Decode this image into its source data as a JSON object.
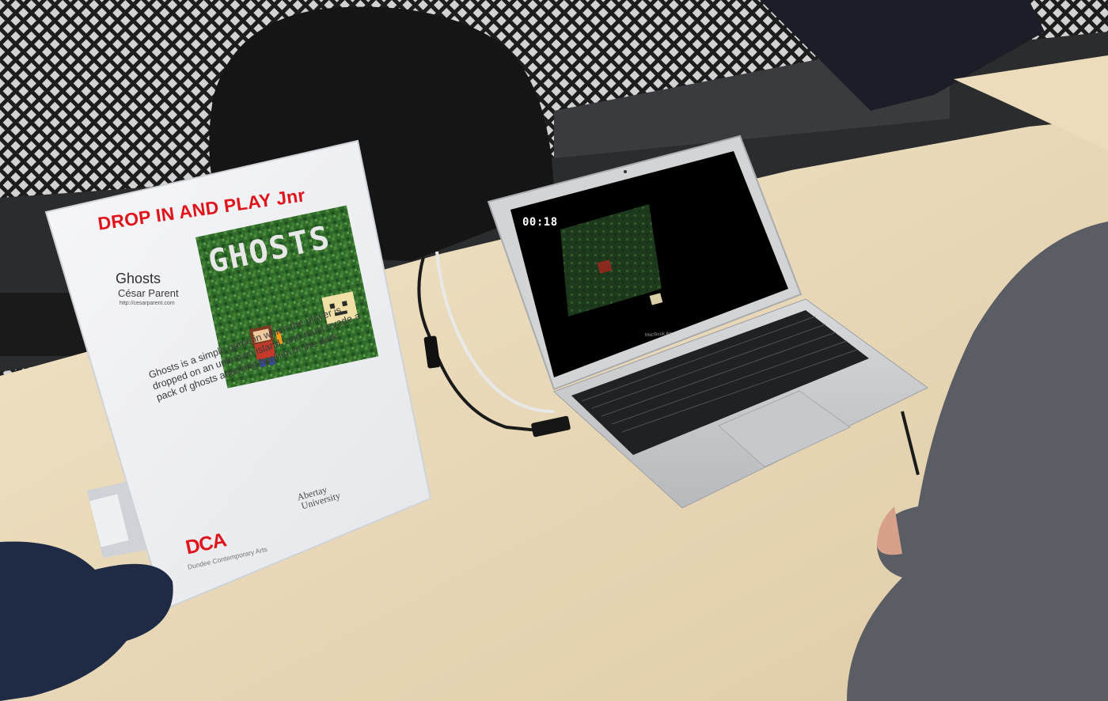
{
  "sign": {
    "title": "DROP IN AND PLAY Jnr",
    "game_name": "Ghosts",
    "author": "César Parent",
    "url": "http://cesarparent.com",
    "description": "Ghosts is a simple game in which the player is dropped on an unknown island, and must evade a pack of ghosts attacking her/him in the dark",
    "box_art_title": "GHOSTS",
    "logo_dca": "DCA",
    "logo_dca_sub": "Dundee Contemporary Arts",
    "logo_university_line1": "Abertay",
    "logo_university_line2": "University"
  },
  "laptop": {
    "timer": "00:18",
    "model": "MacBook Air"
  },
  "colors": {
    "title_red": "#e0141b",
    "table": "#e8d7b6",
    "screen_bg": "#000000",
    "grass": "#2e6b2a"
  }
}
